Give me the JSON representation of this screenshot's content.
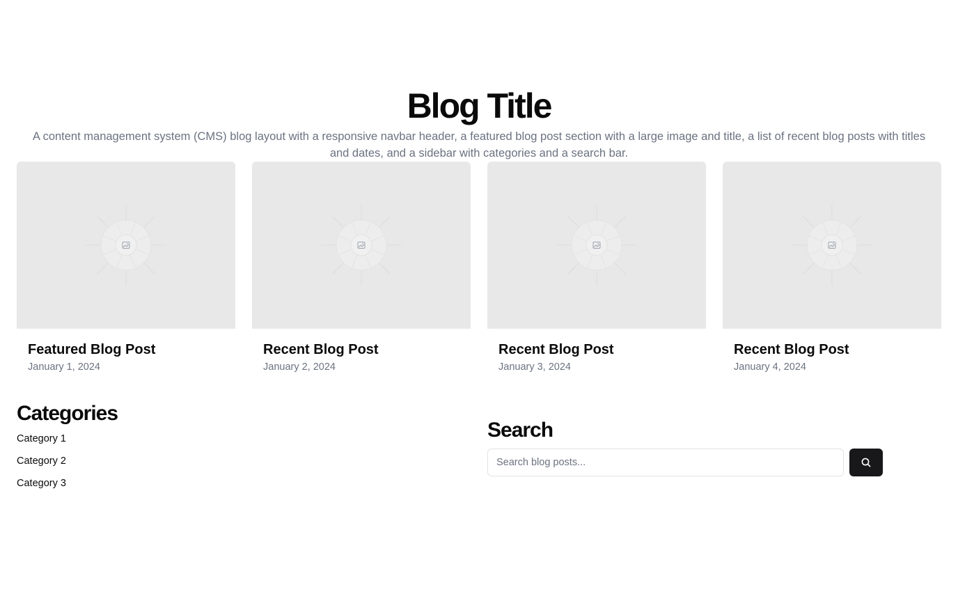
{
  "header": {
    "title": "Blog Title",
    "subtitle": "A content management system (CMS) blog layout with a responsive navbar header, a featured blog post section with a large image and title, a list of recent blog posts with titles and dates, and a sidebar with categories and a search bar."
  },
  "posts": [
    {
      "title": "Featured Blog Post",
      "date": "January 1, 2024",
      "image_icon": "image-placeholder-icon"
    },
    {
      "title": "Recent Blog Post",
      "date": "January 2, 2024",
      "image_icon": "image-placeholder-icon"
    },
    {
      "title": "Recent Blog Post",
      "date": "January 3, 2024",
      "image_icon": "image-placeholder-icon"
    },
    {
      "title": "Recent Blog Post",
      "date": "January 4, 2024",
      "image_icon": "image-placeholder-icon"
    }
  ],
  "categories": {
    "heading": "Categories",
    "items": [
      "Category 1",
      "Category 2",
      "Category 3"
    ]
  },
  "search": {
    "heading": "Search",
    "placeholder": "Search blog posts...",
    "value": "",
    "button_icon": "search-icon"
  },
  "colors": {
    "text": "#0a0a0a",
    "muted": "#6b7280",
    "placeholder_bg": "#e8e8e8",
    "button_bg": "#18181b"
  }
}
